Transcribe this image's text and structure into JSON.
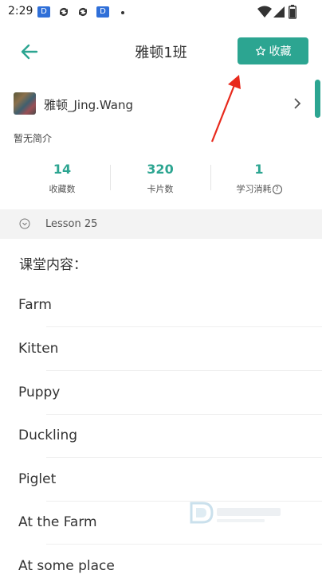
{
  "status_bar": {
    "time": "2:29",
    "app_icons": [
      "d-app-icon",
      "sync-icon",
      "sync-icon",
      "d-app-icon"
    ]
  },
  "header": {
    "title": "雅顿1班",
    "favorite_label": "收藏"
  },
  "author": {
    "name": "雅顿_Jing.Wang",
    "bio": "暂无简介"
  },
  "stats": [
    {
      "value": "14",
      "label": "收藏数"
    },
    {
      "value": "320",
      "label": "卡片数"
    },
    {
      "value": "1",
      "label": "学习消耗"
    }
  ],
  "lesson": {
    "title": "Lesson 25"
  },
  "content": {
    "heading": "课堂内容：",
    "items": [
      "Farm",
      "Kitten",
      "Puppy",
      "Duckling",
      "Piglet",
      "At the Farm",
      "At some place"
    ]
  },
  "colors": {
    "accent": "#2ca591",
    "arrow": "#e8291c"
  }
}
